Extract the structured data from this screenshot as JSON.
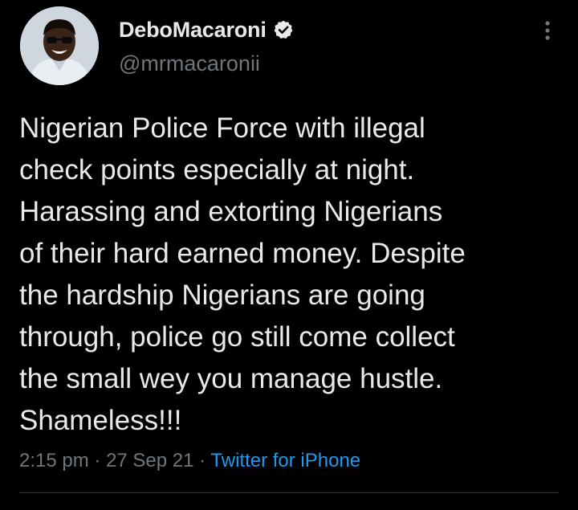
{
  "tweet": {
    "author": {
      "display_name": "DeboMacaroni",
      "handle": "@mrmacaronii",
      "verified": true
    },
    "text": "Nigerian Police Force with illegal\ncheck points especially at night.\nHarassing and extorting Nigerians\nof their hard earned money. Despite\nthe hardship Nigerians are going\nthrough, police go still come collect\nthe small wey you manage hustle.\nShameless!!!",
    "meta": {
      "time": "2:15 pm",
      "separator": "·",
      "date": "27 Sep 21",
      "source": "Twitter for iPhone"
    },
    "icons": {
      "verified": "verified-badge-icon",
      "more": "more-options-icon"
    },
    "colors": {
      "background": "#000000",
      "primary_text": "#e7e9ea",
      "secondary_text": "#71767b",
      "link": "#1d9bf0"
    }
  }
}
